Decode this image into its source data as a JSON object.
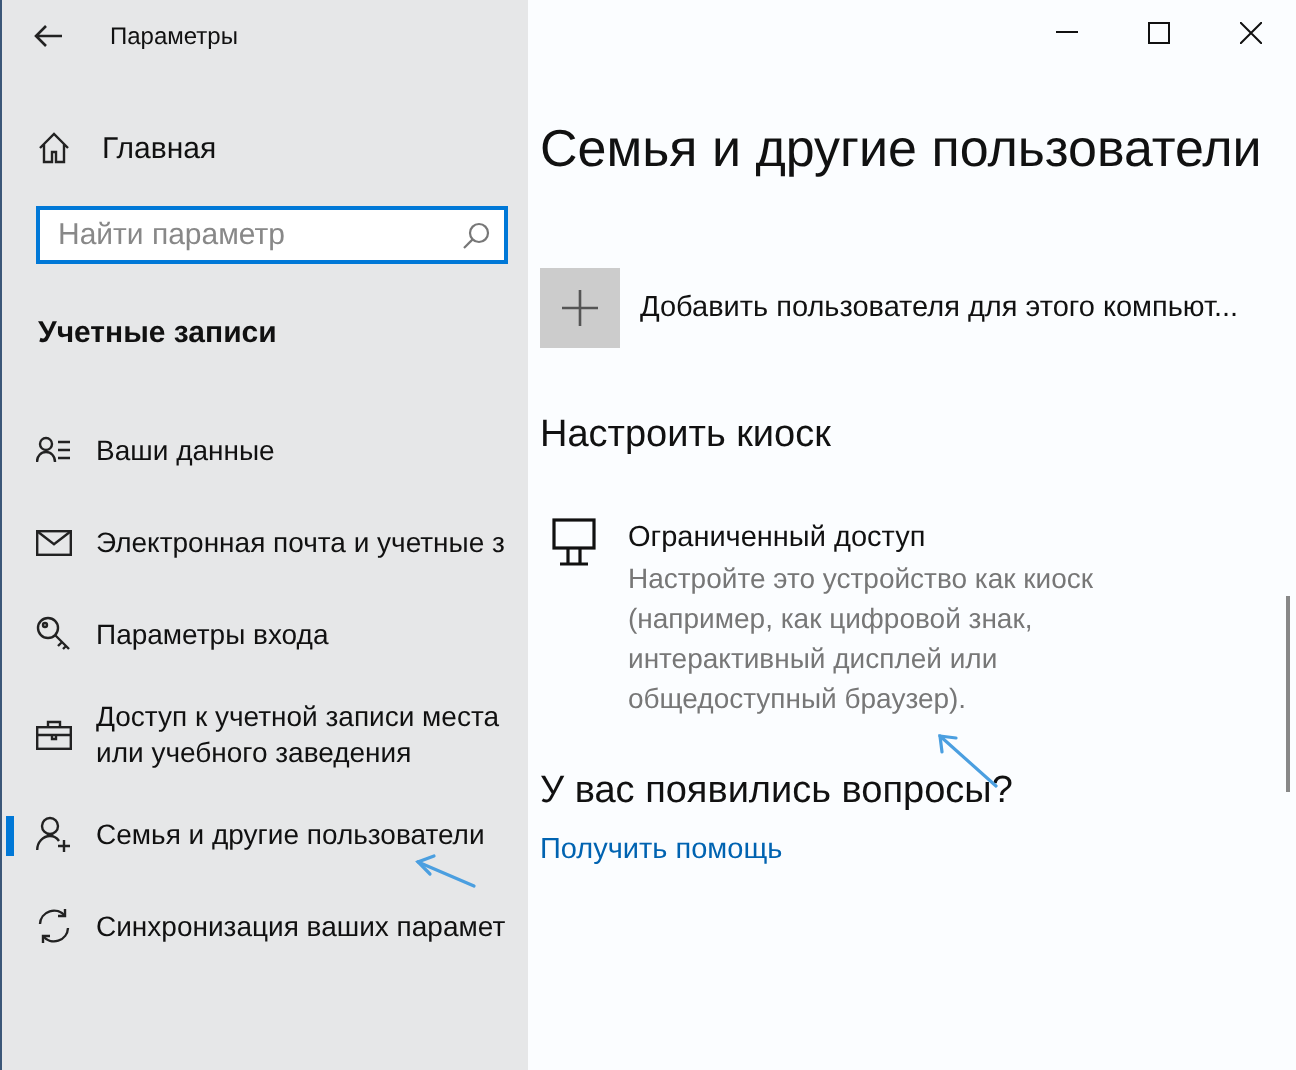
{
  "window": {
    "title": "Параметры"
  },
  "sidebar": {
    "home": "Главная",
    "search": {
      "placeholder": "Найти параметр"
    },
    "section_title": "Учетные записи",
    "items": [
      {
        "label": "Ваши данные",
        "selected": false
      },
      {
        "label": "Электронная почта и учетные з",
        "selected": false
      },
      {
        "label": "Параметры входа",
        "selected": false
      },
      {
        "label": "Доступ к учетной записи места или учебного заведения",
        "selected": false
      },
      {
        "label": "Семья и другие пользователи",
        "selected": true
      },
      {
        "label": "Синхронизация ваших парамет",
        "selected": false
      }
    ]
  },
  "content": {
    "title": "Семья и другие пользователи",
    "add_user": {
      "label": "Добавить пользователя для этого компьют..."
    },
    "kiosk": {
      "heading": "Настроить киоск",
      "item": {
        "title": "Ограниченный доступ",
        "description": "Настройте это устройство как киоск (например, как цифровой знак, интерактивный дисплей или общедоступный браузер)."
      }
    },
    "help": {
      "heading": "У вас появились вопросы?",
      "link": "Получить помощь"
    }
  }
}
